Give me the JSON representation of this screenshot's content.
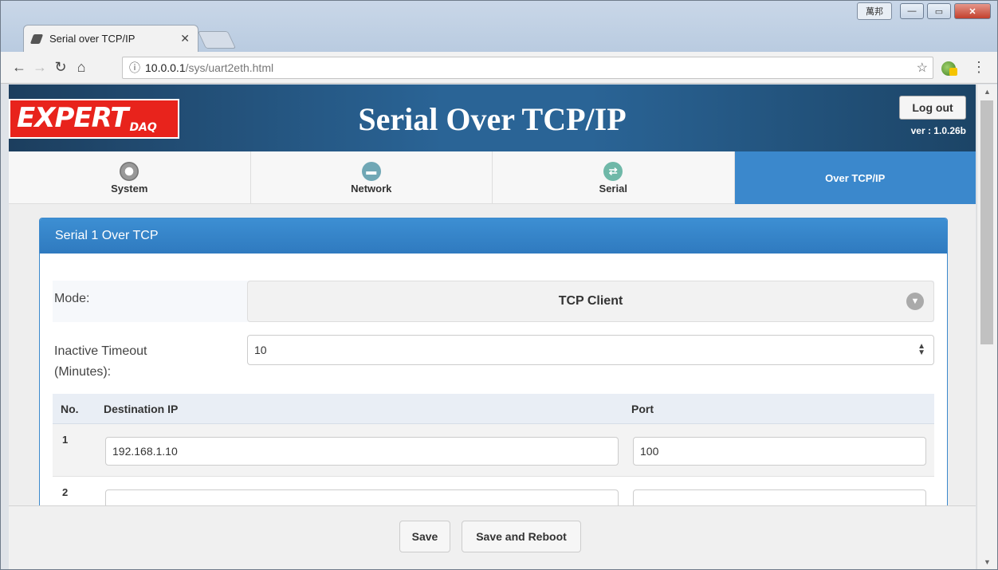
{
  "browser": {
    "tab_title": "Serial over TCP/IP",
    "ime_label": "萬邦",
    "url_host": "10.0.0.1",
    "url_path": "/sys/uart2eth.html"
  },
  "header": {
    "logo_text": "EXPERT",
    "logo_sub": "DAQ",
    "title": "Serial Over TCP/IP",
    "logout_label": "Log out",
    "version": "ver : 1.0.26b"
  },
  "nav": {
    "items": [
      {
        "label": "System",
        "icon": "gear-icon"
      },
      {
        "label": "Network",
        "icon": "network-icon"
      },
      {
        "label": "Serial",
        "icon": "serial-arrows-icon"
      },
      {
        "label": "Over TCP/IP",
        "icon": "",
        "active": true
      }
    ]
  },
  "panel": {
    "title": "Serial 1 Over TCP",
    "mode_label": "Mode:",
    "mode_value": "TCP Client",
    "timeout_label": "Inactive Timeout (Minutes):",
    "timeout_value": "10"
  },
  "table": {
    "col_no": "No.",
    "col_ip": "Destination IP",
    "col_port": "Port",
    "rows": [
      {
        "no": "1",
        "ip": "192.168.1.10",
        "port": "100"
      },
      {
        "no": "2",
        "ip": "",
        "port": ""
      }
    ]
  },
  "footer": {
    "save_label": "Save",
    "reboot_label": "Save and Reboot"
  },
  "colors": {
    "header_bg": "#2a6496",
    "nav_active": "#3b88cc",
    "logo_red": "#e8231c"
  }
}
